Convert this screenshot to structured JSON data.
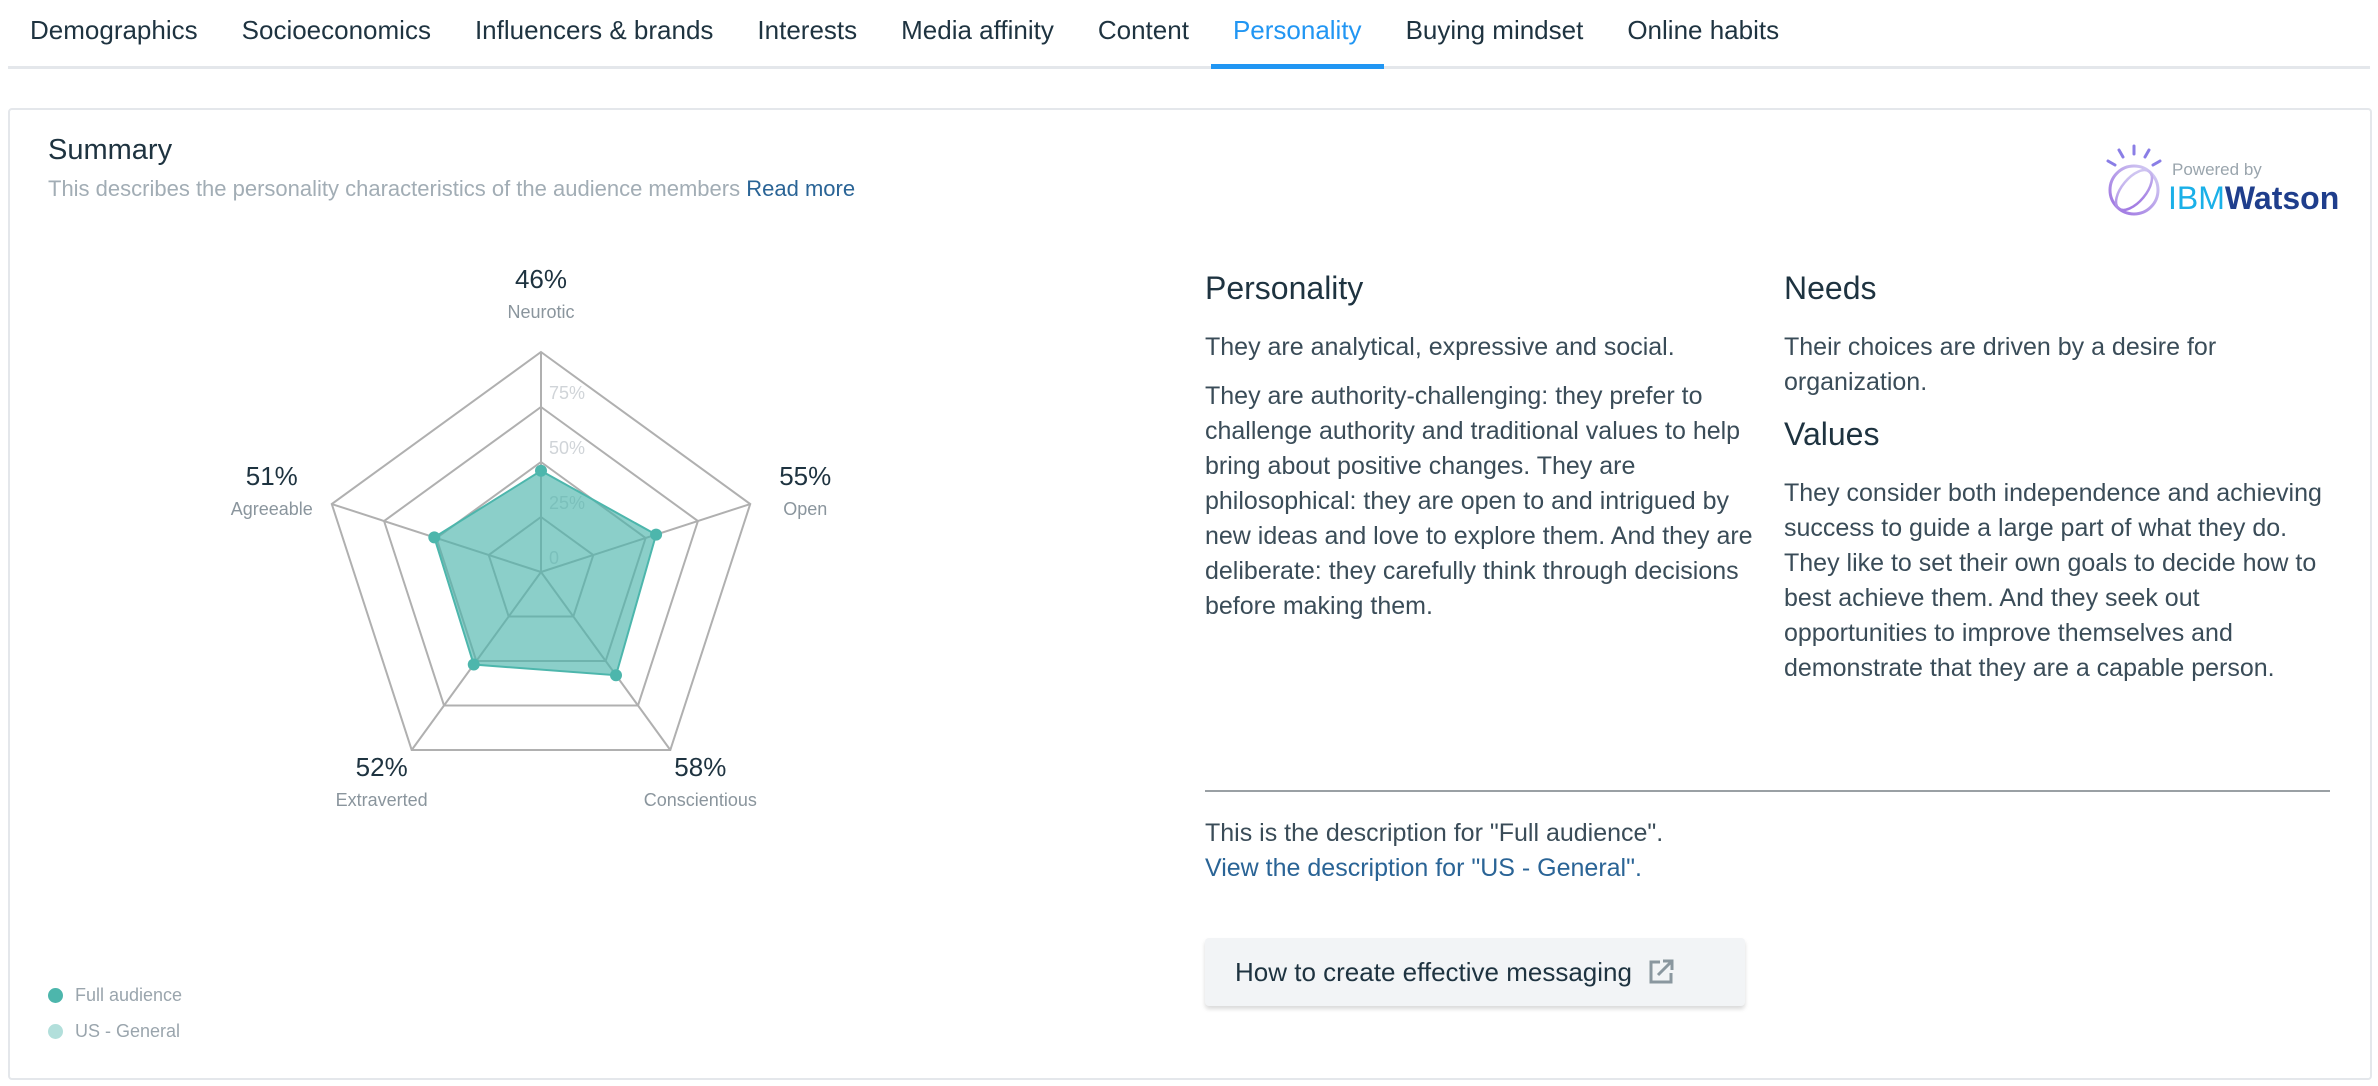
{
  "tabs": [
    {
      "label": "Demographics"
    },
    {
      "label": "Socioeconomics"
    },
    {
      "label": "Influencers & brands"
    },
    {
      "label": "Interests"
    },
    {
      "label": "Media affinity"
    },
    {
      "label": "Content"
    },
    {
      "label": "Personality",
      "active": true
    },
    {
      "label": "Buying mindset"
    },
    {
      "label": "Online habits"
    }
  ],
  "summary": {
    "title": "Summary",
    "subtitle": "This describes the personality characteristics of the audience members",
    "read_more": "Read more",
    "logo": {
      "powered_by": "Powered by",
      "ibm": "IBM",
      "watson": "Watson"
    }
  },
  "chart_data": {
    "type": "radar",
    "axes": [
      "Neurotic",
      "Open",
      "Conscientious",
      "Extraverted",
      "Agreeable"
    ],
    "series": [
      {
        "name": "Full audience",
        "values": [
          46,
          55,
          58,
          52,
          51
        ],
        "color": "#4db6ac"
      }
    ],
    "value_labels": [
      "46%",
      "55%",
      "58%",
      "52%",
      "51%"
    ],
    "ticks": [
      "0",
      "25%",
      "50%",
      "75%"
    ],
    "range": [
      0,
      100
    ],
    "legend": [
      {
        "label": "Full audience",
        "color": "#4db6ac"
      },
      {
        "label": "US - General",
        "color": "#b2dfdb"
      }
    ],
    "legend_placement": "bottom-left"
  },
  "personality": {
    "heading": "Personality",
    "paragraphs": [
      "They are analytical, expressive and social.",
      "They are authority-challenging: they prefer to challenge authority and traditional values to help bring about positive changes. They are philosophical: they are open to and intrigued by new ideas and love to explore them. And they are deliberate: they carefully think through decisions before making them."
    ]
  },
  "needs": {
    "heading": "Needs",
    "text": "Their choices are driven by a desire for organization."
  },
  "values": {
    "heading": "Values",
    "text": "They consider both independence and achieving success to guide a large part of what they do. They like to set their own goals to decide how to best achieve them. And they seek out opportunities to improve themselves and demonstrate that they are a capable person."
  },
  "description": {
    "current": "This is the description for \"Full audience\".",
    "link": "View the description for \"US - General\"."
  },
  "button": {
    "label": "How to create effective messaging",
    "icon": "external-link-icon"
  },
  "colors": {
    "accent": "#2196f3",
    "fill": "#4db6ac",
    "link": "#2a6496"
  }
}
